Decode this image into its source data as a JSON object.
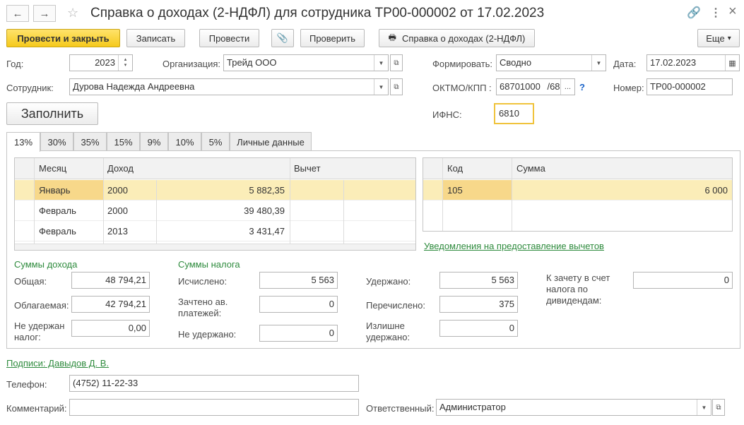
{
  "window": {
    "title": "Справка о доходах (2-НДФЛ) для сотрудника ТР00-000002 от 17.02.2023",
    "back_icon": "←",
    "forward_icon": "→",
    "link_icon": "🔗",
    "menu_icon": "⋮",
    "close_icon": "×"
  },
  "toolbar": {
    "post_close": "Провести и закрыть",
    "write": "Записать",
    "post": "Провести",
    "attach_icon": "📎",
    "check": "Проверить",
    "print_report": "Справка о доходах (2-НДФЛ)",
    "more": "Еще",
    "more_arrow": "▾"
  },
  "header": {
    "year_label": "Год:",
    "year_value": "2023",
    "org_label": "Организация:",
    "org_value": "Трейд ООО",
    "form_label": "Формировать:",
    "form_value": "Сводно",
    "date_label": "Дата:",
    "date_value": "17.02.2023",
    "employee_label": "Сотрудник:",
    "employee_value": "Дурова Надежда Андреевна",
    "oktmo_label": "ОКТМО/КПП :",
    "oktmo_value": "68701000",
    "kpp_value": "/68",
    "ellipsis": "...",
    "help": "?",
    "number_label": "Номер:",
    "number_value": "ТР00-000002",
    "fill_button": "Заполнить",
    "ifns_label": "ИФНС:",
    "ifns_value": "6810"
  },
  "tabs": [
    "13%",
    "30%",
    "35%",
    "15%",
    "9%",
    "10%",
    "5%",
    "Личные данные"
  ],
  "income_table": {
    "columns": [
      "Месяц",
      "Доход",
      "Вычет"
    ],
    "rows": [
      {
        "month": "Январь",
        "code": "2000",
        "amount": "5 882,35",
        "selected": true
      },
      {
        "month": "Февраль",
        "code": "2000",
        "amount": "39 480,39",
        "selected": false
      },
      {
        "month": "Февраль",
        "code": "2013",
        "amount": "3 431,47",
        "selected": false
      }
    ]
  },
  "deduction_table": {
    "columns": [
      "Код",
      "Сумма"
    ],
    "rows": [
      {
        "code": "105",
        "sum": "6 000"
      }
    ]
  },
  "deduction_notices_link": "Уведомления на предоставление вычетов",
  "income_sums": {
    "heading": "Суммы дохода",
    "total_label": "Общая:",
    "total_value": "48 794,21",
    "taxable_label": "Облагаемая:",
    "taxable_value": "42 794,21",
    "not_withheld_label": "Не удержан налог:",
    "not_withheld_value": "0,00"
  },
  "tax_sums": {
    "heading": "Суммы налога",
    "calculated_label": "Исчислено:",
    "calculated_value": "5 563",
    "advance_label": "Зачтено ав. платежей:",
    "advance_value": "0",
    "not_withheld_label": "Не удержано:",
    "not_withheld_value": "0",
    "withheld_label": "Удержано:",
    "withheld_value": "5 563",
    "transferred_label": "Перечислено:",
    "transferred_value": "375",
    "excess_label": "Излишне удержано:",
    "excess_value": "0",
    "dividends_label": "К зачету в счет налога по дивидендам:",
    "dividends_value": "0"
  },
  "footer": {
    "signatures_link": "Подписи: Давыдов Д. В.",
    "phone_label": "Телефон:",
    "phone_value": "(4752) 11-22-33",
    "comment_label": "Комментарий:",
    "comment_value": "",
    "responsible_label": "Ответственный:",
    "responsible_value": "Администратор"
  },
  "colors": {
    "primary_button": "#f5c91c",
    "selected_row": "#fbedb8",
    "selected_cell": "#f7d88a",
    "green_text": "#2e8b3d",
    "active_field_border": "#f0c33c"
  }
}
